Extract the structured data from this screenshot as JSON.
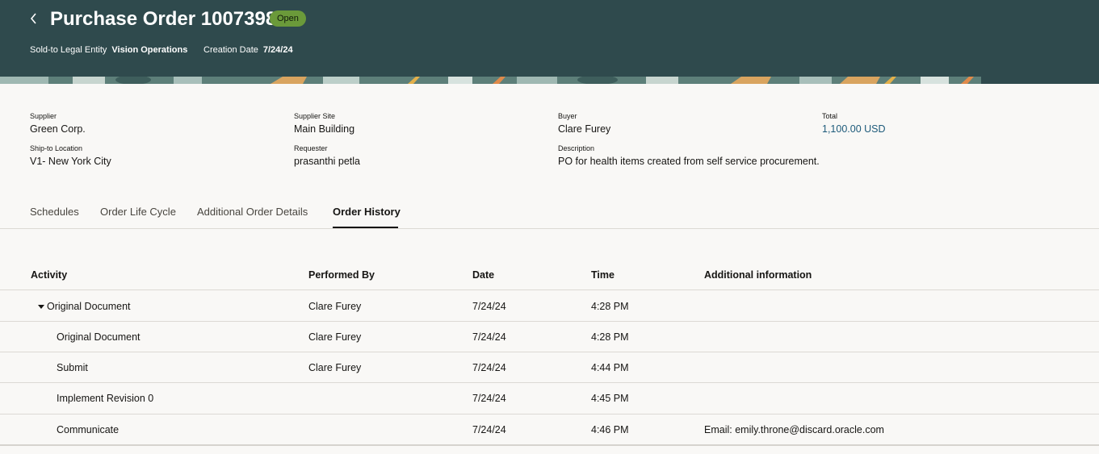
{
  "header": {
    "back_icon": "chevron-left-icon",
    "title": "Purchase Order 1007398",
    "status": "Open",
    "status_color": "#6b9a3a",
    "bg_color": "#2f4a4d",
    "sold_to_label": "Sold-to Legal Entity",
    "sold_to_value": "Vision Operations",
    "creation_date_label": "Creation Date",
    "creation_date_value": "7/24/24"
  },
  "summary": {
    "supplier_label": "Supplier",
    "supplier_value": "Green Corp.",
    "supplier_site_label": "Supplier Site",
    "supplier_site_value": "Main Building",
    "buyer_label": "Buyer",
    "buyer_value": "Clare Furey",
    "total_label": "Total",
    "total_value": "1,100.00 USD",
    "ship_to_label": "Ship-to Location",
    "ship_to_value": "V1- New York City",
    "requester_label": "Requester",
    "requester_value": "prasanthi petla",
    "description_label": "Description",
    "description_value": "PO for health items created from self service procurement."
  },
  "tabs": [
    {
      "label": "Schedules",
      "active": false
    },
    {
      "label": "Order Life Cycle",
      "active": false
    },
    {
      "label": "Additional Order Details",
      "active": false
    },
    {
      "label": "Order History",
      "active": true
    }
  ],
  "table": {
    "columns": [
      "Activity",
      "Performed By",
      "Date",
      "Time",
      "Additional information"
    ],
    "rows": [
      {
        "activity": "Original Document",
        "performed_by": "Clare Furey",
        "date": "7/24/24",
        "time": "4:28 PM",
        "info": "",
        "expanded": true,
        "level": 0
      },
      {
        "activity": "Original Document",
        "performed_by": "Clare Furey",
        "date": "7/24/24",
        "time": "4:28 PM",
        "info": "",
        "level": 1
      },
      {
        "activity": "Submit",
        "performed_by": "Clare Furey",
        "date": "7/24/24",
        "time": "4:44 PM",
        "info": "",
        "level": 1
      },
      {
        "activity": "Implement Revision 0",
        "performed_by": "",
        "date": "7/24/24",
        "time": "4:45 PM",
        "info": "",
        "level": 1
      },
      {
        "activity": "Communicate",
        "performed_by": "",
        "date": "7/24/24",
        "time": "4:46 PM",
        "info": "Email: emily.throne@discard.oracle.com",
        "level": 1
      }
    ]
  }
}
